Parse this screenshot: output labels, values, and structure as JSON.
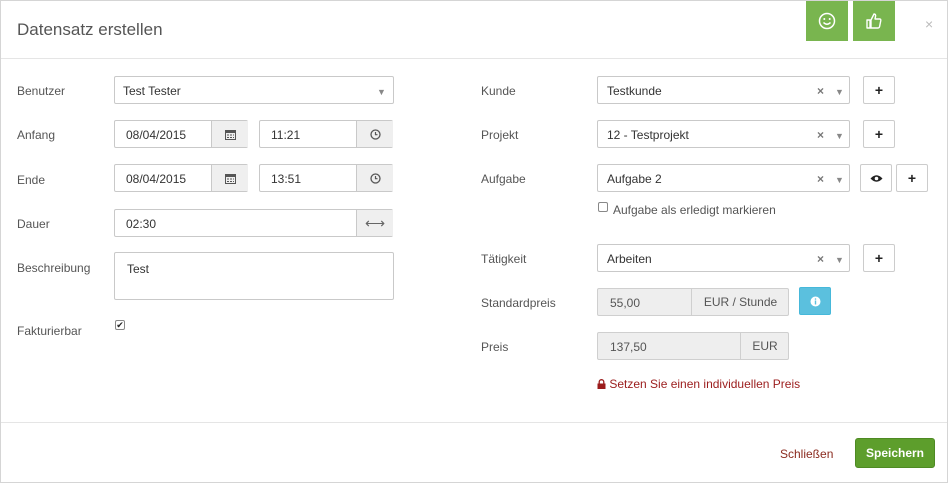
{
  "dialog": {
    "title": "Datensatz erstellen",
    "close_symbol": "×"
  },
  "header_buttons": {
    "smiley_icon": "smiley-icon",
    "thumbs_icon": "thumbs-up-icon"
  },
  "left": {
    "user_label": "Benutzer",
    "user_value": "Test Tester",
    "start_label": "Anfang",
    "start_date": "08/04/2015",
    "start_time": "11:21",
    "end_label": "Ende",
    "end_date": "08/04/2015",
    "end_time": "13:51",
    "duration_label": "Dauer",
    "duration_value": "02:30",
    "description_label": "Beschreibung",
    "description_value": "Test",
    "billable_label": "Fakturierbar",
    "billable_checked": true
  },
  "right": {
    "customer_label": "Kunde",
    "customer_value": "Testkunde",
    "project_label": "Projekt",
    "project_value": "12 - Testprojekt",
    "task_label": "Aufgabe",
    "task_value": "Aufgabe 2",
    "task_done_label": "Aufgabe als erledigt markieren",
    "activity_label": "Tätigkeit",
    "activity_value": "Arbeiten",
    "std_price_label": "Standardpreis",
    "std_price_value": "55,00",
    "std_price_unit": "EUR / Stunde",
    "price_label": "Preis",
    "price_value": "137,50",
    "price_unit": "EUR",
    "custom_price_link": "Setzen Sie einen individuellen Preis"
  },
  "symbols": {
    "clear": "×",
    "caret": "▼",
    "plus": "+",
    "swap": "⟷"
  },
  "footer": {
    "close_label": "Schließen",
    "save_label": "Speichern"
  },
  "colors": {
    "green": "#79b54f",
    "save_green": "#5d9e2c",
    "info_blue": "#5bc0de",
    "link_red": "#8b2b1f"
  }
}
